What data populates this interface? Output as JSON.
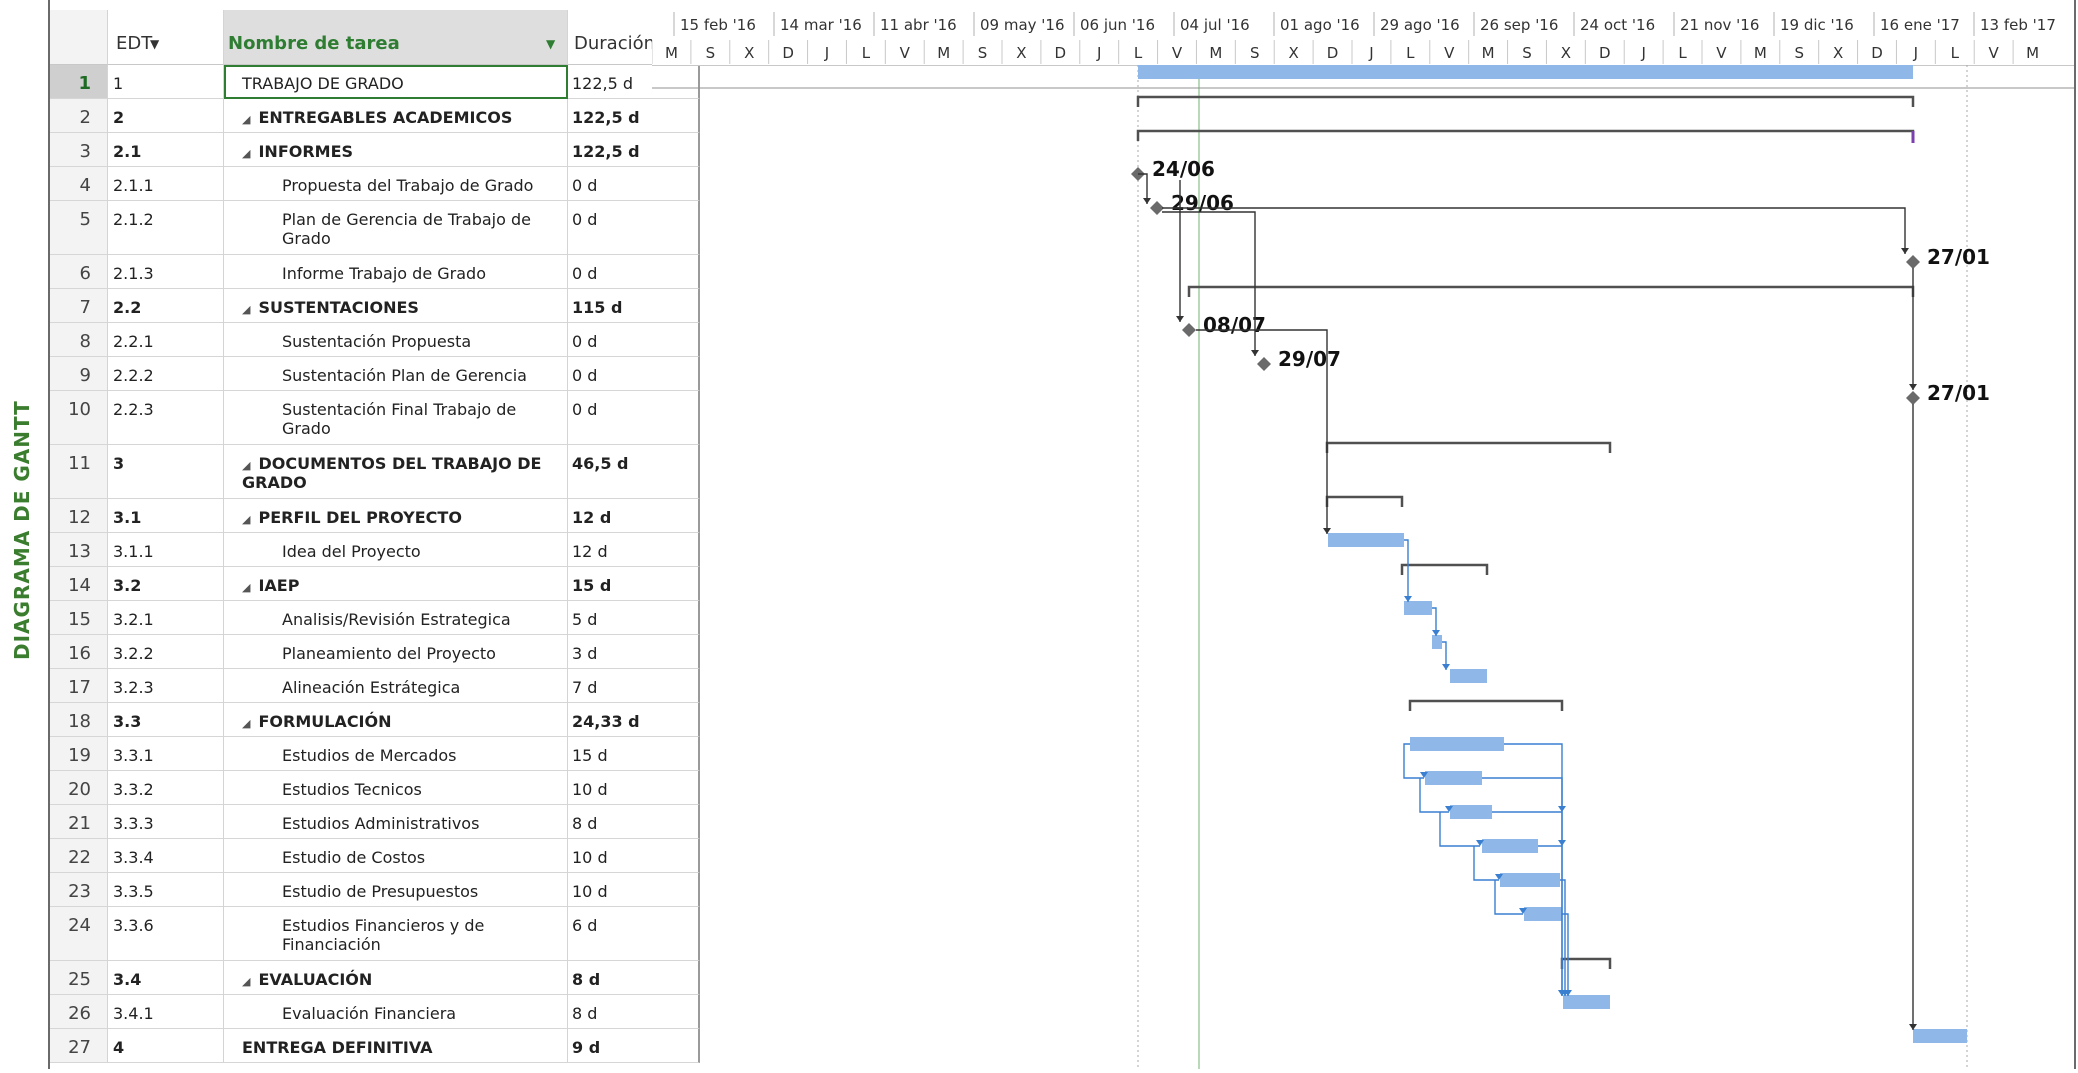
{
  "side_label": "DIAGRAMA DE GANTT",
  "columns": {
    "edt": "EDT",
    "name": "Nombre de tarea",
    "duration": "Duración"
  },
  "timescale": {
    "top": [
      "15 feb '16",
      "14 mar '16",
      "11 abr '16",
      "09 may '16",
      "06 jun '16",
      "04 jul '16",
      "01 ago '16",
      "29 ago '16",
      "26 sep '16",
      "24 oct '16",
      "21 nov '16",
      "19 dic '16",
      "16 ene '17",
      "13 feb '17"
    ],
    "bottom": [
      "M",
      "S",
      "X",
      "D",
      "J",
      "L",
      "V",
      "M",
      "S",
      "X",
      "D",
      "J",
      "L",
      "V",
      "M",
      "S",
      "X",
      "D",
      "J",
      "L",
      "V",
      "M",
      "S",
      "X",
      "D",
      "J",
      "L",
      "V",
      "M",
      "S",
      "X",
      "D",
      "J",
      "L",
      "V",
      "M"
    ]
  },
  "tasks": [
    {
      "id": "1",
      "edt": "1",
      "name": "TRABAJO DE GRADO",
      "dur": "122,5 d",
      "level": 0,
      "bold": false,
      "summary": false,
      "selected": true
    },
    {
      "id": "2",
      "edt": "2",
      "name": "ENTREGABLES ACADEMICOS",
      "dur": "122,5 d",
      "level": 0,
      "bold": true,
      "summary": true
    },
    {
      "id": "3",
      "edt": "2.1",
      "name": "INFORMES",
      "dur": "122,5 d",
      "level": 1,
      "bold": true,
      "summary": true
    },
    {
      "id": "4",
      "edt": "2.1.1",
      "name": "Propuesta del Trabajo de Grado",
      "dur": "0 d",
      "level": 2
    },
    {
      "id": "5",
      "edt": "2.1.2",
      "name": "Plan de Gerencia de Trabajo de Grado",
      "dur": "0 d",
      "level": 2
    },
    {
      "id": "6",
      "edt": "2.1.3",
      "name": "Informe Trabajo de Grado",
      "dur": "0 d",
      "level": 2
    },
    {
      "id": "7",
      "edt": "2.2",
      "name": "SUSTENTACIONES",
      "dur": "115 d",
      "level": 1,
      "bold": true,
      "summary": true
    },
    {
      "id": "8",
      "edt": "2.2.1",
      "name": "Sustentación Propuesta",
      "dur": "0 d",
      "level": 2
    },
    {
      "id": "9",
      "edt": "2.2.2",
      "name": "Sustentación Plan de Gerencia",
      "dur": "0 d",
      "level": 2
    },
    {
      "id": "10",
      "edt": "2.2.3",
      "name": "Sustentación Final Trabajo de Grado",
      "dur": "0 d",
      "level": 2
    },
    {
      "id": "11",
      "edt": "3",
      "name": "DOCUMENTOS DEL TRABAJO DE GRADO",
      "dur": "46,5 d",
      "level": 0,
      "bold": true,
      "summary": true
    },
    {
      "id": "12",
      "edt": "3.1",
      "name": "PERFIL DEL PROYECTO",
      "dur": "12 d",
      "level": 1,
      "bold": true,
      "summary": true
    },
    {
      "id": "13",
      "edt": "3.1.1",
      "name": "Idea del Proyecto",
      "dur": "12 d",
      "level": 2
    },
    {
      "id": "14",
      "edt": "3.2",
      "name": "IAEP",
      "dur": "15 d",
      "level": 1,
      "bold": true,
      "summary": true
    },
    {
      "id": "15",
      "edt": "3.2.1",
      "name": "Analisis/Revisión Estrategica",
      "dur": "5 d",
      "level": 2
    },
    {
      "id": "16",
      "edt": "3.2.2",
      "name": "Planeamiento del Proyecto",
      "dur": "3 d",
      "level": 2
    },
    {
      "id": "17",
      "edt": "3.2.3",
      "name": "Alineación Estrátegica",
      "dur": "7 d",
      "level": 2
    },
    {
      "id": "18",
      "edt": "3.3",
      "name": "FORMULACIÓN",
      "dur": "24,33 d",
      "level": 1,
      "bold": true,
      "summary": true
    },
    {
      "id": "19",
      "edt": "3.3.1",
      "name": "Estudios de Mercados",
      "dur": "15 d",
      "level": 2
    },
    {
      "id": "20",
      "edt": "3.3.2",
      "name": "Estudios Tecnicos",
      "dur": "10 d",
      "level": 2
    },
    {
      "id": "21",
      "edt": "3.3.3",
      "name": "Estudios Administrativos",
      "dur": "8 d",
      "level": 2
    },
    {
      "id": "22",
      "edt": "3.3.4",
      "name": "Estudio de Costos",
      "dur": "10 d",
      "level": 2
    },
    {
      "id": "23",
      "edt": "3.3.5",
      "name": "Estudio de Presupuestos",
      "dur": "10 d",
      "level": 2
    },
    {
      "id": "24",
      "edt": "3.3.6",
      "name": "Estudios Financieros y de Financiación",
      "dur": "6 d",
      "level": 2
    },
    {
      "id": "25",
      "edt": "3.4",
      "name": "EVALUACIÓN",
      "dur": "8 d",
      "level": 1,
      "bold": true,
      "summary": true
    },
    {
      "id": "26",
      "edt": "3.4.1",
      "name": "Evaluación Financiera",
      "dur": "8 d",
      "level": 2
    },
    {
      "id": "27",
      "edt": "4",
      "name": "ENTREGA DEFINITIVA",
      "dur": "9 d",
      "level": 0,
      "bold": true,
      "summary": false
    }
  ],
  "milestone_labels": {
    "m4": "24/06",
    "m5": "29/06",
    "m6": "27/01",
    "m8": "08/07",
    "m9": "29/07",
    "m10": "27/01"
  },
  "colors": {
    "bar": "#8fb8e8",
    "summary": "#505050",
    "link": "#3a7fd0",
    "accent": "#2e7d32",
    "milestone": "#6a6a6a"
  }
}
